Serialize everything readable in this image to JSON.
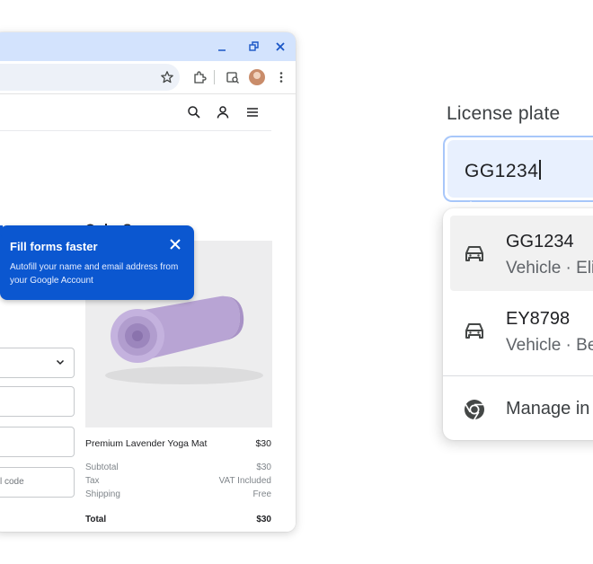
{
  "order_summary": {
    "title": "Order Summary",
    "product_name": "Premium Lavender Yoga Mat",
    "product_price": "$30",
    "rows": [
      {
        "label": "Subtotal",
        "value": "$30"
      },
      {
        "label": "Tax",
        "value": "VAT Included"
      },
      {
        "label": "Shipping",
        "value": "Free"
      }
    ],
    "total_label": "Total",
    "total_value": "$30"
  },
  "form": {
    "code_placeholder_fragment": "l code"
  },
  "bubble": {
    "title": "Fill forms faster",
    "body": "Autofill your name and email address from your Google Account"
  },
  "license": {
    "label": "License plate",
    "value": "GG1234",
    "suggestions": [
      {
        "main": "GG1234",
        "sub": "Vehicle · Eli",
        "icon": "car-icon"
      },
      {
        "main": "EY8798",
        "sub": "Vehicle · Be",
        "icon": "car-icon"
      }
    ],
    "manage_label": "Manage in",
    "manage_icon": "chrome-icon"
  },
  "colors": {
    "titlebar": "#d3e3fd",
    "bubble": "#0b57d0",
    "input_fill": "#e8f0fe",
    "focus_ring": "#a8c7fa"
  }
}
